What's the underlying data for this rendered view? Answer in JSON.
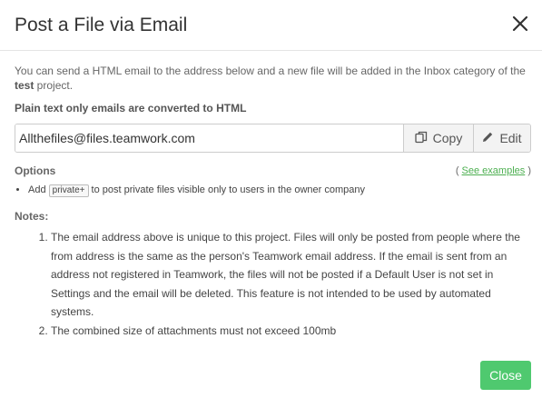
{
  "dialog": {
    "title": "Post a File via Email",
    "close_icon": "close-icon"
  },
  "intro": {
    "text_before": "You can send a HTML email to the address below and a new file will be added in the Inbox category of the ",
    "project": "test",
    "text_after": " project.",
    "plain_note": "Plain text only emails are converted to HTML"
  },
  "email": {
    "address": "Allthefiles@files.teamwork.com",
    "copy_label": "Copy",
    "copy_icon": "copy-icon",
    "edit_label": "Edit",
    "edit_icon": "pencil-icon"
  },
  "options": {
    "label": "Options",
    "see_prefix": "( ",
    "see_link": "See examples",
    "see_suffix": " )",
    "items": [
      {
        "before": "Add ",
        "tag": "private+",
        "after": " to post private files visible only to users in the owner company"
      }
    ]
  },
  "notes": {
    "label": "Notes:",
    "items": [
      "The email address above is unique to this project. Files will only be posted from people where the from address is the same as the person's Teamwork email address. If the email is sent from an address not registered in Teamwork, the files will not be posted if a Default User is not set in Settings and the email will be deleted. This feature is not intended to be used by automated systems.",
      "The combined size of attachments must not exceed 100mb"
    ]
  },
  "footer": {
    "close_label": "Close"
  },
  "colors": {
    "accent_green": "#4fc96f",
    "link_green": "#4caf50"
  }
}
